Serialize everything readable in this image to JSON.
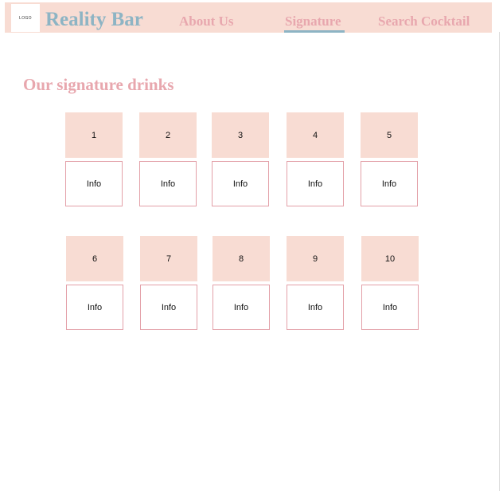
{
  "header": {
    "logo_text": "LOGO",
    "brand": "Reality Bar",
    "nav": {
      "about": "About Us",
      "signature": "Signature",
      "search": "Search Cocktail"
    },
    "active_tab": "Signature"
  },
  "main": {
    "title": "Our signature drinks",
    "drinks": [
      {
        "number": "1",
        "info": "Info"
      },
      {
        "number": "2",
        "info": "Info"
      },
      {
        "number": "3",
        "info": "Info"
      },
      {
        "number": "4",
        "info": "Info"
      },
      {
        "number": "5",
        "info": "Info"
      },
      {
        "number": "6",
        "info": "Info"
      },
      {
        "number": "7",
        "info": "Info"
      },
      {
        "number": "8",
        "info": "Info"
      },
      {
        "number": "9",
        "info": "Info"
      },
      {
        "number": "10",
        "info": "Info"
      }
    ]
  },
  "colors": {
    "header_bg": "#f8dcd3",
    "brand": "#8db4c4",
    "accent_pink": "#e8a7ae",
    "card_border": "#e3a0a8"
  }
}
